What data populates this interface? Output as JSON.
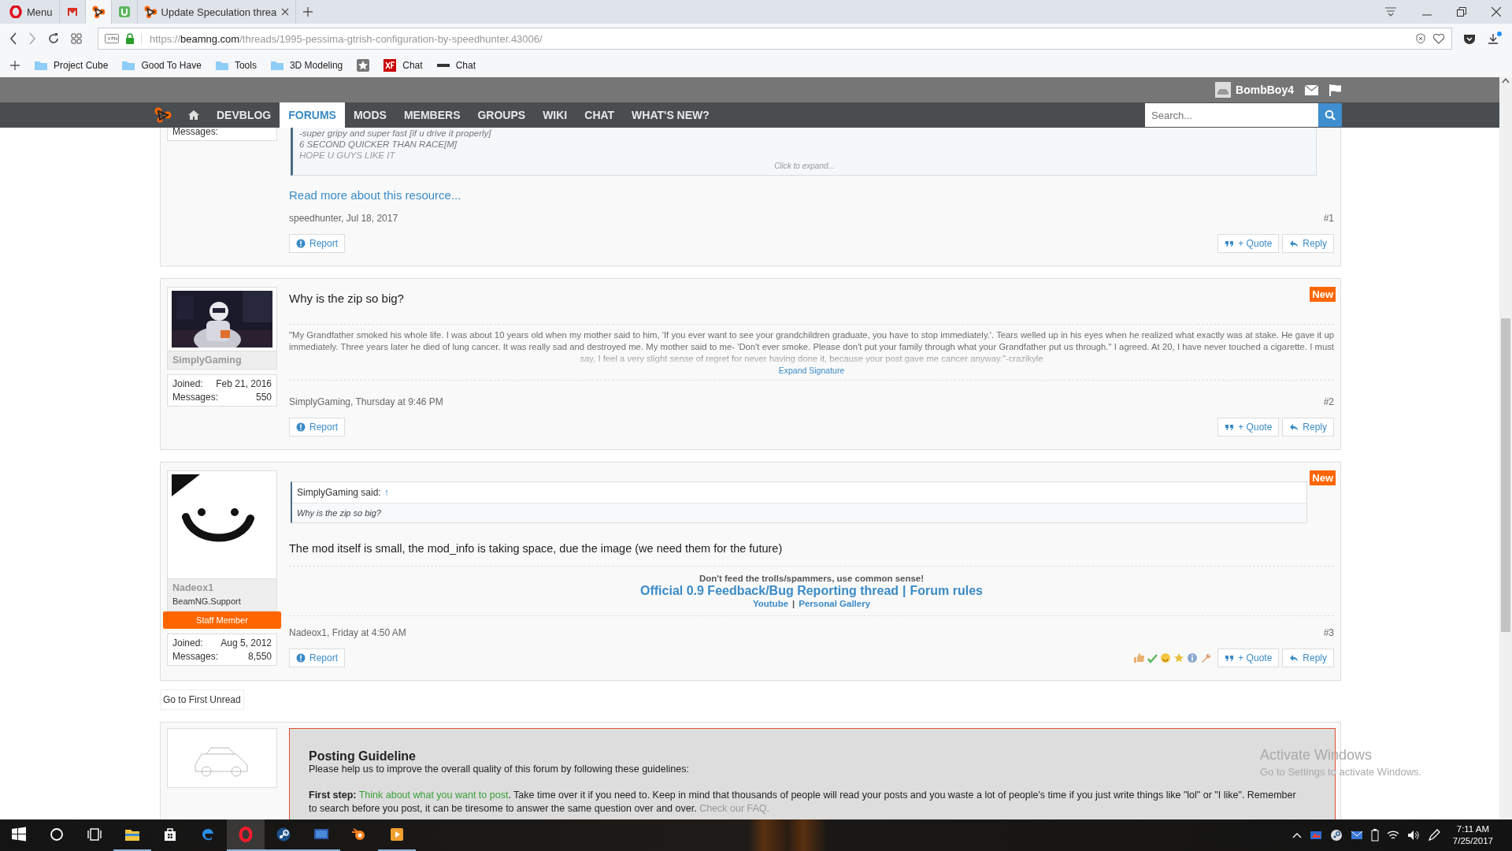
{
  "browser": {
    "tabs": [
      {
        "kind": "menu",
        "label": "Menu",
        "selected": false
      },
      {
        "kind": "gmail",
        "selected": false
      },
      {
        "kind": "beamng",
        "selected": true
      },
      {
        "kind": "utorrent",
        "selected": false
      },
      {
        "kind": "page",
        "label": "Update Speculation threa",
        "selected": false
      }
    ],
    "address": {
      "scheme": "https://",
      "host": "beamng.com",
      "path": "/threads/1995-pessima-gtrish-configuration-by-speedhunter.43006/"
    },
    "bookmarks": [
      {
        "kind": "folder",
        "label": "Project Cube"
      },
      {
        "kind": "folder",
        "label": "Good To Have"
      },
      {
        "kind": "folder",
        "label": "Tools"
      },
      {
        "kind": "folder",
        "label": "3D Modeling"
      },
      {
        "kind": "star"
      },
      {
        "kind": "xf",
        "label": "Chat"
      },
      {
        "kind": "dash",
        "label": "Chat"
      }
    ]
  },
  "site": {
    "user": "BombBoy4",
    "nav": [
      {
        "kind": "home",
        "selected": false
      },
      {
        "kind": "text",
        "label": "DEVBLOG",
        "selected": false
      },
      {
        "kind": "text",
        "label": "FORUMS",
        "selected": true
      },
      {
        "kind": "text",
        "label": "MODS",
        "selected": false
      },
      {
        "kind": "text",
        "label": "MEMBERS",
        "selected": false
      },
      {
        "kind": "text",
        "label": "GROUPS",
        "selected": false
      },
      {
        "kind": "text",
        "label": "WIKI",
        "selected": false
      },
      {
        "kind": "text",
        "label": "CHAT",
        "selected": false
      },
      {
        "kind": "text",
        "label": "WHAT'S NEW?",
        "selected": false
      }
    ],
    "search": {
      "placeholder": "Search..."
    }
  },
  "posts": [
    {
      "user": {
        "stats": [
          {
            "label": "Messages:"
          }
        ]
      },
      "blocks": [
        {
          "kind": "bbquote",
          "lines": [
            "-super gripy and super fast [if u drive it properly]",
            "6 SECOND QUICKER THAN RACE[M]",
            "HOPE U GUYS LIKE IT"
          ],
          "expand": "Click to expand..."
        },
        {
          "kind": "link",
          "text": "Read more about this resource..."
        }
      ],
      "meta": "speedhunter, Jul 18, 2017",
      "number": "#1",
      "actions": [
        {
          "kind": "report",
          "label": "Report"
        },
        {
          "kind": "quote",
          "label": "+ Quote"
        },
        {
          "kind": "reply",
          "label": "Reply"
        }
      ]
    },
    {
      "user": {
        "name": "SimplyGaming",
        "stats": [
          {
            "label": "Joined:",
            "value": "Feb 21, 2016"
          },
          {
            "label": "Messages:",
            "value": "550"
          }
        ]
      },
      "badge": "New",
      "blocks": [
        {
          "kind": "title",
          "text": "Why is the zip so big?"
        },
        {
          "kind": "signature",
          "text": "\"My Grandfather smoked his whole life. I was about 10 years old when my mother said to him, 'If you ever want to see your grandchildren graduate, you have to stop immediately.'. Tears welled up in his eyes when he realized what exactly was at stake. He gave it up immediately. Three years later he died of lung cancer. It was really sad and destroyed me. My mother said to me- 'Don't ever smoke. Please don't put your family through what your Grandfather put us through.\" I agreed. At 20, I have never touched a cigarette. I must say, I feel a very slight sense of regret for never having done it, because your post gave me cancer anyway.\"-crazikyle",
          "expand": "Expand Signature"
        }
      ],
      "meta": "SimplyGaming, Thursday at 9:46 PM",
      "number": "#2",
      "actions": [
        {
          "kind": "report",
          "label": "Report"
        },
        {
          "kind": "quote",
          "label": "+ Quote"
        },
        {
          "kind": "reply",
          "label": "Reply"
        }
      ]
    },
    {
      "user": {
        "avatar": {
          "kind": "drawing"
        },
        "name": "Nadeox1",
        "title": "BeamNG.Support",
        "ribbon": "Staff Member",
        "stats": [
          {
            "label": "Joined:",
            "value": "Aug 5, 2012"
          },
          {
            "label": "Messages:",
            "value": "8,550"
          }
        ]
      },
      "badge": "New",
      "blocks": [
        {
          "kind": "quote",
          "author": "SimplyGaming said:",
          "jump": "↑",
          "text": "Why is the zip so big?"
        },
        {
          "kind": "message",
          "text": "The mod itself is small, the mod_info is taking space, due the image (we need them for the future)"
        },
        {
          "kind": "siglines",
          "lines": [
            {
              "kind": "bold",
              "items": [
                "Don't feed the trolls/spammers, use common sense!"
              ]
            },
            {
              "kind": "biglinks",
              "items": [
                "Official 0.9 Feedback/Bug Reporting thread",
                "Forum rules"
              ],
              "separator": "|"
            },
            {
              "kind": "links",
              "items": [
                "Youtube",
                "Personal Gallery"
              ],
              "separator": "|"
            }
          ]
        }
      ],
      "meta": "Nadeox1, Friday at 4:50 AM",
      "number": "#3",
      "reactions": [
        {
          "kind": "like"
        },
        {
          "kind": "check"
        },
        {
          "kind": "smile"
        },
        {
          "kind": "star"
        },
        {
          "kind": "info"
        },
        {
          "kind": "wrench"
        }
      ],
      "actions": [
        {
          "kind": "report",
          "label": "Report"
        },
        {
          "kind": "quote",
          "label": "+ Quote"
        },
        {
          "kind": "reply",
          "label": "Reply"
        }
      ]
    }
  ],
  "first_unread": "Go to First Unread",
  "guideline": {
    "title": "Posting Guideline",
    "intro": "Please help us to improve the overall quality of this forum by following these guidelines:",
    "step": {
      "label": "First step:",
      "highlight": "Think about what you want to post",
      "body": ". Take time over it if you need to. Keep in mind that thousands of people will read your posts and you waste a lot of people's time if you just write things like \"lol\" or \"I like\". Remember to search before you post, it can be tiresome to answer the same question over and over.",
      "link": "Check our FAQ."
    }
  },
  "activation": {
    "title": "Activate Windows",
    "text": "Go to Settings to activate Windows."
  },
  "taskbar": {
    "apps": [
      {
        "kind": "explorer",
        "running": true,
        "selected": false
      },
      {
        "kind": "store",
        "running": false,
        "selected": false
      },
      {
        "kind": "edge",
        "running": false,
        "selected": false
      },
      {
        "kind": "opera",
        "running": true,
        "selected": true
      },
      {
        "kind": "steam",
        "running": true,
        "selected": false
      },
      {
        "kind": "monitor",
        "running": true,
        "selected": false
      },
      {
        "kind": "blender",
        "running": false,
        "selected": false
      },
      {
        "kind": "media",
        "running": true,
        "selected": false
      }
    ],
    "time": "7:11 AM",
    "date": "7/25/2017"
  }
}
